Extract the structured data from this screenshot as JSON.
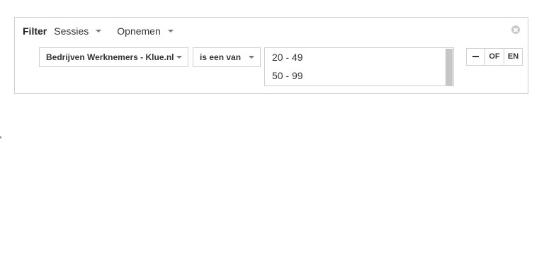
{
  "filter": {
    "title": "Filter",
    "scope_dropdown": {
      "label": "Sessies",
      "icon": "chevron-down-icon"
    },
    "action_dropdown": {
      "label": "Opnemen",
      "icon": "chevron-down-icon"
    },
    "close_icon": "close-circle-icon"
  },
  "condition": {
    "dimension": "Bedrijven Werknemers - Klue.nl",
    "operator": "is een van",
    "values": [
      "20 - 49",
      "50 - 99"
    ]
  },
  "logic_buttons": {
    "remove_icon": "minus-icon",
    "or_label": "OF",
    "and_label": "EN"
  }
}
